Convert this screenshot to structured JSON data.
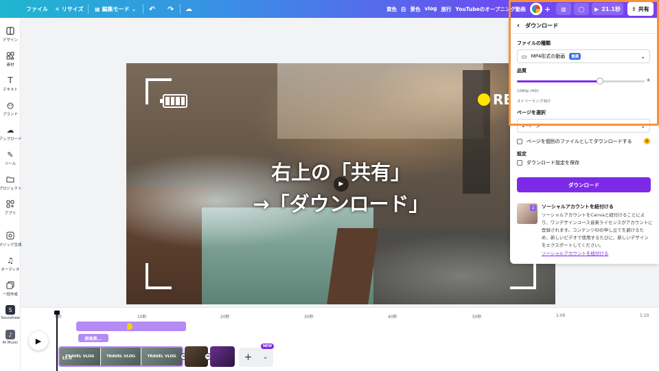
{
  "topbar": {
    "file": "ファイル",
    "resize": "リサイズ",
    "edit_mode": "編集モード",
    "tags": [
      "黄色",
      "白",
      "景色",
      "vlog",
      "旅行",
      "YouTubeのオープニング動画"
    ],
    "timer": "21.1秒",
    "share": "共有"
  },
  "sidebar": {
    "items": [
      {
        "label": "デザイン",
        "icon": "layout-icon"
      },
      {
        "label": "素材",
        "icon": "elements-icon"
      },
      {
        "label": "テキスト",
        "icon": "text-icon"
      },
      {
        "label": "ブランド",
        "icon": "brand-icon"
      },
      {
        "label": "アップロード",
        "icon": "upload-icon"
      },
      {
        "label": "ツール",
        "icon": "tools-icon"
      },
      {
        "label": "プロジェクト",
        "icon": "folder-icon"
      },
      {
        "label": "アプリ",
        "icon": "apps-icon"
      },
      {
        "label": "マジック生成",
        "icon": "magic-icon"
      },
      {
        "label": "オーディオ",
        "icon": "music-icon"
      },
      {
        "label": "一括作成",
        "icon": "bulk-icon"
      },
      {
        "label": "Soundraw",
        "icon": "soundraw-icon"
      },
      {
        "label": "AI Music",
        "icon": "ai-music-icon"
      }
    ]
  },
  "canvas": {
    "rec_label": "REC",
    "overlay_line1": "右上の「共有」",
    "overlay_line2": "→「ダウンロード」"
  },
  "download_panel": {
    "title": "ダウンロード",
    "file_type_label": "ファイルの種類",
    "file_type_value": "MP4形式の動画",
    "file_type_badge": "推奨",
    "quality_label": "品質",
    "quality_value": 0.65,
    "quality_text": "1080p (HD)",
    "quality_sub": "ストリーミング向け",
    "pages_label": "ページを選択",
    "pages_value": "1 ページ",
    "separate_files_label": "ページを個別のファイルとしてダウンロードする",
    "settings_label": "設定",
    "save_settings_label": "ダウンロード設定を保存",
    "download_button": "ダウンロード",
    "social_title": "ソーシャルアカウントを紐付ける",
    "social_text": "ソーシャルアカウントをCanvaと紐付けることにより、ワンデザインユース音楽ライセンスがアカウントに登録されます。コンテンツIDの申し立てを避けるため、新しいビデオで使用するたびに、新しいデザインをエクスポートしてください。",
    "social_link": "ソーシャルアカウントを紐付ける"
  },
  "timeline": {
    "ticks": [
      "0秒",
      "10秒",
      "20秒",
      "30秒",
      "40秒",
      "50秒",
      "1:00",
      "1:10"
    ],
    "tag_label": "群馬県...",
    "clip_labels": [
      "TRAVEL VLOG",
      "TRAVEL VLOG",
      "TRAVEL VLOG"
    ],
    "clip_duration": "15.0",
    "new_badge": "NEW"
  }
}
